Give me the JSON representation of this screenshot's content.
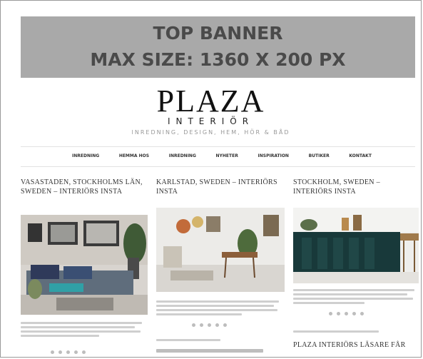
{
  "banner": {
    "line1": "TOP BANNER",
    "line2": "MAX SIZE: 1360 X 200 PX"
  },
  "logo": {
    "title": "PLAZA",
    "subtitle": "INTERIÖR",
    "tagline": "INREDNING, DESIGN, HEM, HÖR & BÅD"
  },
  "nav": [
    "INREDNING",
    "HEMMA HOS",
    "INREDNING",
    "NYHETER",
    "INSPIRATION",
    "BUTIKER",
    "KONTAKT"
  ],
  "posts": [
    {
      "title": "VASASTADEN, STOCKHOLMS LÄN, SWEDEN – INTERIÖRS INSTA"
    },
    {
      "title": "KARLSTAD, SWEDEN – INTERIÖRS INSTA"
    },
    {
      "title": "STOCKHOLM, SWEDEN – INTERIÖRS INSTA"
    }
  ],
  "next_post_title": "PLAZA INTERIÖRS LÄSARE FÅR",
  "colors": {
    "banner_bg": "#a9a9a9",
    "banner_text": "#4a4a4a",
    "frame": "#9a9a9a"
  }
}
